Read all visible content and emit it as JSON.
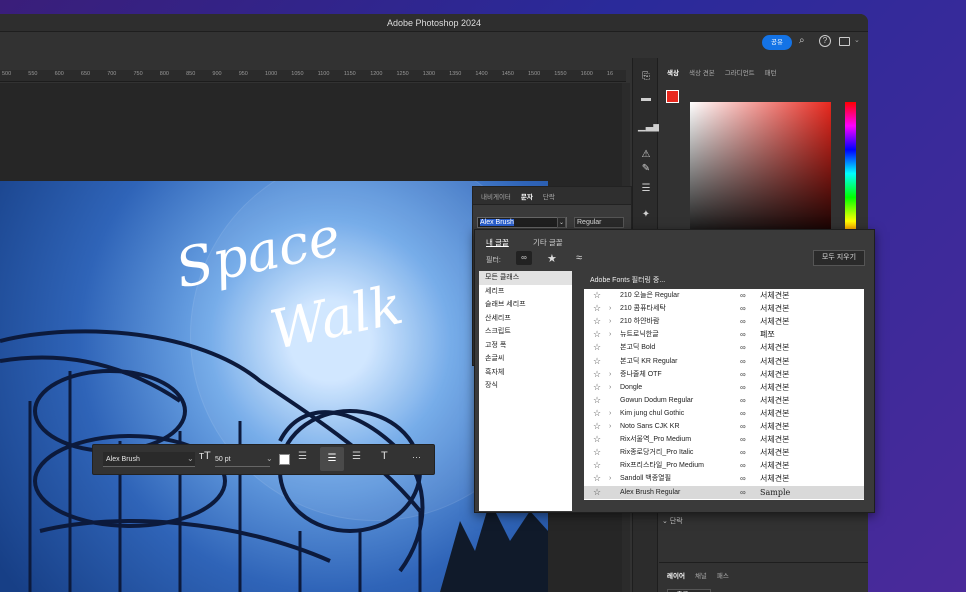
{
  "window": {
    "title": "Adobe Photoshop 2024"
  },
  "appbar": {
    "share_label": "공유"
  },
  "ruler": {
    "ticks": [
      "500",
      "550",
      "600",
      "650",
      "700",
      "750",
      "800",
      "850",
      "900",
      "950",
      "1000",
      "1050",
      "1100",
      "1150",
      "1200",
      "1250",
      "1300",
      "1350",
      "1400",
      "1450",
      "1500",
      "1550",
      "1600",
      "16"
    ]
  },
  "canvas": {
    "title_line1": "Space",
    "title_line2": "Walk"
  },
  "color_panel": {
    "tabs": [
      "색상",
      "색상 견본",
      "그라디언트",
      "패턴"
    ]
  },
  "character_panel": {
    "tabs": [
      "내비게이터",
      "문자",
      "단락"
    ],
    "font_value": "Alex Brush",
    "style_value": "Regular"
  },
  "font_popup": {
    "tab_my_fonts": "내 글꼴",
    "tab_more_fonts": "기타 글꼴",
    "filter_label": "필터:",
    "clear_all": "모두 지우기",
    "status": "Adobe Fonts 필터링 중...",
    "classes": [
      "모든 클래스",
      "세리프",
      "슬래브 세리프",
      "산세리프",
      "스크립트",
      "고정 폭",
      "손글씨",
      "흑자체",
      "장식"
    ],
    "fonts": [
      {
        "name": "210 오늘은 Regular",
        "sample": "서체견본",
        "chevron": false
      },
      {
        "name": "210 콤퓨타세탁",
        "sample": "서체견본",
        "chevron": true
      },
      {
        "name": "210 하얀바람",
        "sample": "서체견본",
        "chevron": true
      },
      {
        "name": "뉴트로닉한글",
        "sample": "폐쪼",
        "chevron": true
      },
      {
        "name": "본고딕 Bold",
        "sample": "서체견본",
        "chevron": false
      },
      {
        "name": "본고딕 KR Regular",
        "sample": "서체견본",
        "chevron": false
      },
      {
        "name": "증나줄체 OTF",
        "sample": "서체견본",
        "chevron": true
      },
      {
        "name": "Dongle",
        "sample": "서체견본",
        "chevron": true
      },
      {
        "name": "Gowun Dodum Regular",
        "sample": "서체견본",
        "chevron": false
      },
      {
        "name": "Kim jung chul Gothic",
        "sample": "서체견본",
        "chevron": true
      },
      {
        "name": "Noto Sans CJK KR",
        "sample": "서체견본",
        "chevron": true
      },
      {
        "name": "Rix서울역_Pro Medium",
        "sample": "서체견본",
        "chevron": false
      },
      {
        "name": "Rix종로당거리_Pro Italic",
        "sample": "서체견본",
        "chevron": false
      },
      {
        "name": "Rix프리스타일_Pro Medium",
        "sample": "서체견본",
        "chevron": false
      },
      {
        "name": "Sandoll 백종열필",
        "sample": "서체견본",
        "chevron": true
      },
      {
        "name": "Alex Brush Regular",
        "sample": "Sample",
        "chevron": false
      }
    ]
  },
  "floating_toolbar": {
    "font": "Alex Brush",
    "size": "50 pt",
    "more": "···"
  },
  "paragraph_section": {
    "label": "단락"
  },
  "layers_panel": {
    "tabs": [
      "레이어",
      "채널",
      "패스"
    ],
    "kind_filter": "종류"
  },
  "colors": {
    "accent": "#1473e6",
    "foreground": "#e8281e"
  }
}
